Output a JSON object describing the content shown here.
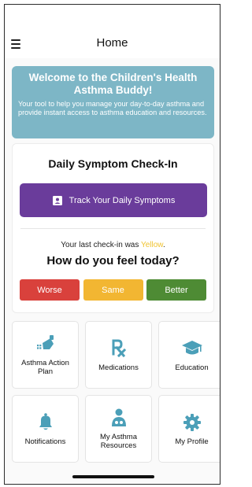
{
  "header": {
    "title": "Home",
    "menu_icon": "hamburger-menu-icon"
  },
  "banner": {
    "title": "Welcome to the Children's Health Asthma Buddy!",
    "text": "Your tool to help you manage your day-to-day asthma and provide instant access to asthma education and resources.",
    "color": "#7db6c6"
  },
  "checkin": {
    "title": "Daily Symptom Check-In",
    "track_label": "Track Your Daily Symptoms",
    "track_icon": "symptom-tracker-icon",
    "track_color": "#6a3c9b",
    "last_prefix": "Your last check-in was ",
    "last_value": "Yellow",
    "last_suffix": ".",
    "question": "How do you feel today?",
    "options": [
      {
        "label": "Worse",
        "color": "#d9413c"
      },
      {
        "label": "Same",
        "color": "#f2b632"
      },
      {
        "label": "Better",
        "color": "#4e8b34"
      }
    ]
  },
  "tiles": [
    {
      "label": "Asthma Action Plan",
      "icon": "action-plan-icon"
    },
    {
      "label": "Medications",
      "icon": "prescription-rx-icon"
    },
    {
      "label": "Education",
      "icon": "graduation-cap-icon"
    },
    {
      "label": "Notifications",
      "icon": "bell-icon"
    },
    {
      "label": "My Asthma Resources",
      "icon": "resources-person-icon"
    },
    {
      "label": "My Profile",
      "icon": "gear-icon"
    }
  ],
  "colors": {
    "icon_teal": "#4b9fb8"
  }
}
